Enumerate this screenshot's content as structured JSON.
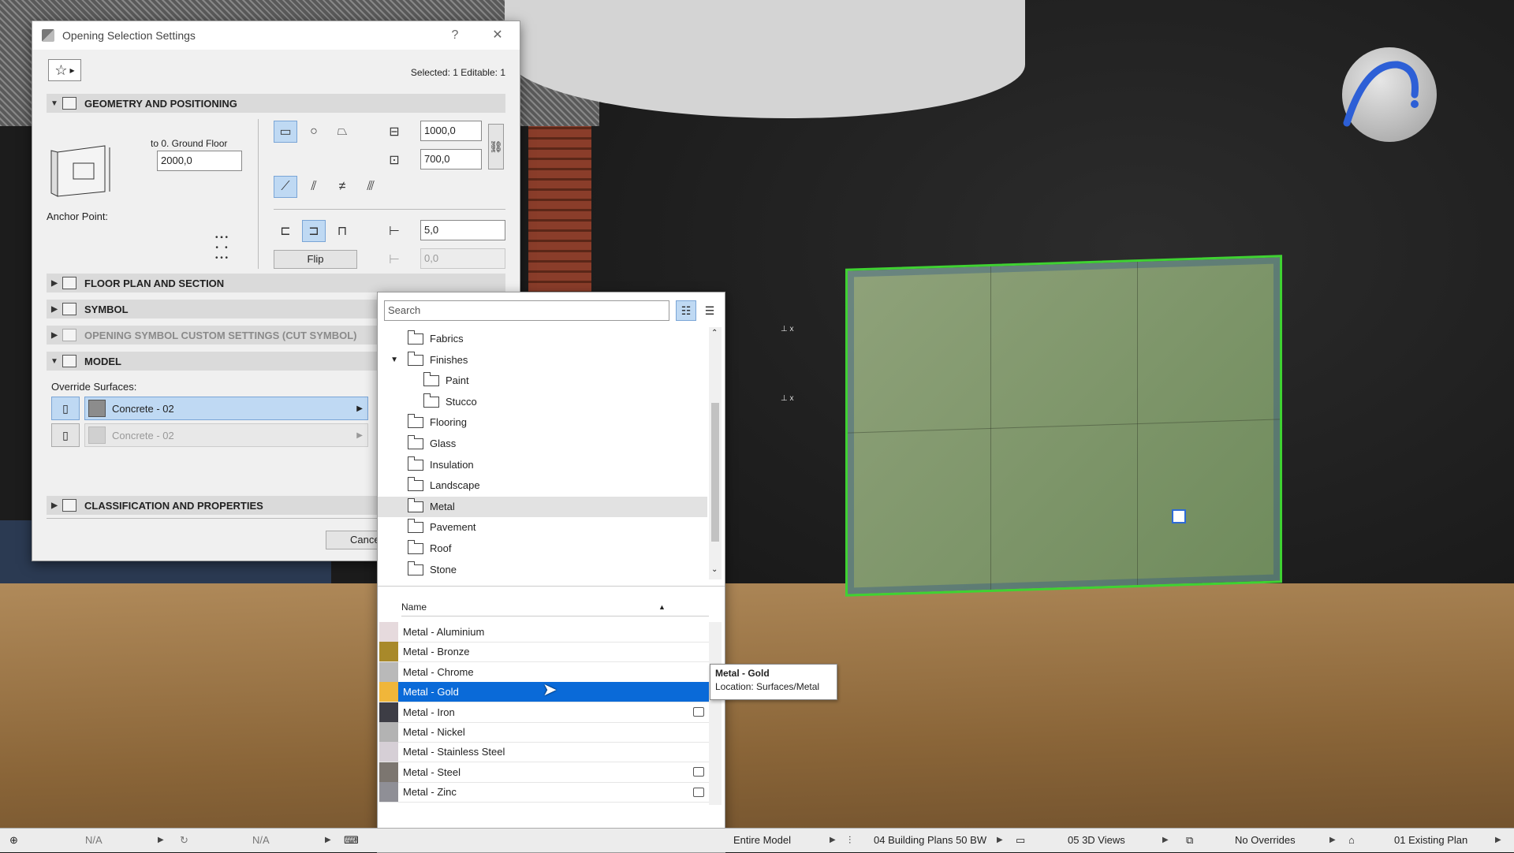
{
  "dialog": {
    "title": "Opening Selection Settings",
    "help": "?",
    "close": "✕",
    "selected_info": "Selected: 1 Editable: 1",
    "sections": {
      "geometry": "GEOMETRY AND POSITIONING",
      "floor_plan": "FLOOR PLAN AND SECTION",
      "symbol": "SYMBOL",
      "custom": "OPENING SYMBOL CUSTOM SETTINGS (CUT SYMBOL)",
      "model": "MODEL",
      "classification": "CLASSIFICATION AND PROPERTIES"
    },
    "to_floor": "to 0. Ground Floor",
    "elevation": "2000,0",
    "anchor_label": "Anchor Point:",
    "width": "1000,0",
    "height": "700,0",
    "offset": "5,0",
    "offset2": "0,0",
    "flip": "Flip",
    "override_label": "Override Surfaces:",
    "surface1": "Concrete - 02",
    "surface2": "Concrete - 02",
    "cancel": "Cance"
  },
  "picker": {
    "search_placeholder": "Search",
    "folders": [
      {
        "name": "Fabrics",
        "indent": 0
      },
      {
        "name": "Finishes",
        "indent": 0,
        "expanded": true
      },
      {
        "name": "Paint",
        "indent": 1
      },
      {
        "name": "Stucco",
        "indent": 1
      },
      {
        "name": "Flooring",
        "indent": 0
      },
      {
        "name": "Glass",
        "indent": 0
      },
      {
        "name": "Insulation",
        "indent": 0
      },
      {
        "name": "Landscape",
        "indent": 0
      },
      {
        "name": "Metal",
        "indent": 0,
        "selected": true
      },
      {
        "name": "Pavement",
        "indent": 0
      },
      {
        "name": "Roof",
        "indent": 0
      },
      {
        "name": "Stone",
        "indent": 0
      }
    ],
    "column_name": "Name",
    "surfaces": [
      {
        "name": "Metal - Aluminium",
        "color": "#e6dadd",
        "icon": false
      },
      {
        "name": "Metal - Bronze",
        "color": "#a8892a",
        "icon": false
      },
      {
        "name": "Metal - Chrome",
        "color": "#b9b9b9",
        "icon": false
      },
      {
        "name": "Metal - Gold",
        "color": "#f0b63a",
        "icon": false,
        "selected": true
      },
      {
        "name": "Metal - Iron",
        "color": "#3d3d45",
        "icon": true
      },
      {
        "name": "Metal - Nickel",
        "color": "#b3b3b3",
        "icon": false
      },
      {
        "name": "Metal - Stainless Steel",
        "color": "#d6cfd6",
        "icon": false
      },
      {
        "name": "Metal - Steel",
        "color": "#7c7670",
        "icon": true
      },
      {
        "name": "Metal - Zinc",
        "color": "#8f8f96",
        "icon": true
      }
    ]
  },
  "tooltip": {
    "title": "Metal - Gold",
    "location": "Location: Surfaces/Metal"
  },
  "statusbar": {
    "na1": "N/A",
    "na2": "N/A",
    "model": "Entire Model",
    "plans": "04 Building Plans 50 BW",
    "views": "05 3D Views",
    "overrides": "No Overrides",
    "existing": "01 Existing Plan"
  },
  "colors": {
    "accent": "#0a6ad8",
    "selection_green": "#3fd232"
  }
}
